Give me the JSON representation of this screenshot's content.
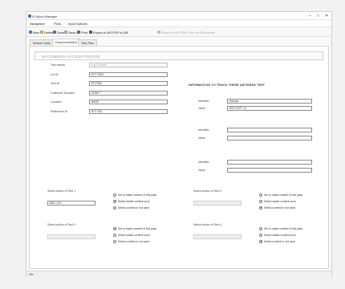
{
  "window": {
    "title": "IS Myco Manager",
    "controls": [
      "–",
      "□",
      "✕"
    ]
  },
  "menu": [
    "Navigation",
    "Plots",
    "Input Options"
  ],
  "toolbar": [
    {
      "label": "New",
      "icon": "new-icon",
      "color": "#4a7fc1",
      "disabled": false
    },
    {
      "label": "Delete",
      "icon": "delete-icon",
      "color": "#d9a13a",
      "disabled": false
    },
    {
      "label": "Save",
      "icon": "save-icon",
      "color": "#3a78c2",
      "disabled": false
    },
    {
      "label": "Save as",
      "icon": "save-as-icon",
      "color": "#8ea6c8",
      "disabled": false
    },
    {
      "label": "Print",
      "icon": "print-icon",
      "color": "#5c6e87",
      "disabled": false
    },
    {
      "label": "Export to MS PDF to DB",
      "icon": "export-icon",
      "color": "#2c6f3a",
      "disabled": false
    },
    {
      "label": "Export to MS PDF Form to DB entries",
      "icon": "export-disabled-icon",
      "color": "#b8c3d1",
      "disabled": true
    }
  ],
  "tabs": [
    "Master Data",
    "Documentation",
    "Test Plan"
  ],
  "active_tab": 1,
  "form_title": "MYCOMEDIA ACCESS PERIOD",
  "left_fields": [
    {
      "label": "Test values",
      "value": "e.g. Product",
      "gray": true
    },
    {
      "label": "Lot ID",
      "value": "PCT-0001",
      "gray": false
    },
    {
      "label": "Test ID",
      "value": "PCT008",
      "gray": false
    },
    {
      "label": "Customer Decision",
      "value": "DRAFT",
      "gray": false
    },
    {
      "label": "Location",
      "value": "BASE",
      "gray": false
    },
    {
      "label": "Reference ID",
      "value": "ECT-001",
      "gray": false
    }
  ],
  "right_section": {
    "header": "INFORMATION TO TRACK THESE ANTIGENS TEST",
    "groups": [
      {
        "rows": [
          {
            "label": "Identifier",
            "value": "Sample"
          },
          {
            "label": "Value",
            "value": "REF-CRTT-11"
          }
        ]
      },
      {
        "rows": [
          {
            "label": "Identifier",
            "value": ""
          },
          {
            "label": "Value",
            "value": ""
          }
        ]
      },
      {
        "rows": [
          {
            "label": "Identifier",
            "value": ""
          },
          {
            "label": "Value",
            "value": ""
          }
        ]
      }
    ]
  },
  "selectors": [
    {
      "title": "Select action of Test 1",
      "value": "ABC-123",
      "disabled": false,
      "options": [
        "Set to make content of this pass",
        "Select stable content once",
        "Select content in not used"
      ],
      "selected": 1
    },
    {
      "title": "Select action of Test 2",
      "value": "",
      "disabled": true,
      "options": [
        "Set to make content of this pass",
        "Select stable content once",
        "Select content in not used"
      ],
      "selected": 2
    },
    {
      "title": "Select action of Test 3",
      "value": "",
      "disabled": true,
      "options": [
        "Set to make content of this pass",
        "Select stable content once",
        "Select content in not used"
      ],
      "selected": 0
    },
    {
      "title": "Select action of Test 4",
      "value": "",
      "disabled": true,
      "options": [
        "Set to make content of this pass",
        "Select stable content once",
        "Select content in not used"
      ],
      "selected": 2
    }
  ],
  "status": "Idle"
}
